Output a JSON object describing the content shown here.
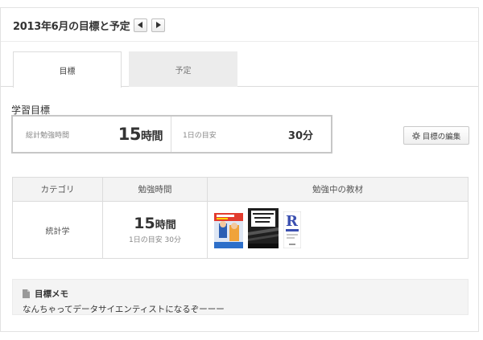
{
  "header": {
    "title": "2013年6月の目標と予定",
    "prev_icon": "triangle-left-icon",
    "next_icon": "triangle-right-icon"
  },
  "tabs": [
    {
      "label": "目標",
      "active": true
    },
    {
      "label": "予定",
      "active": false
    }
  ],
  "goal": {
    "section_label": "学習目標",
    "total_label": "総計勉強時間",
    "total_value": "15",
    "total_unit": "時間",
    "daily_label": "1日の目安",
    "daily_value": "30分"
  },
  "edit_button": {
    "label": "目標の編集",
    "icon": "gear-icon"
  },
  "table": {
    "headers": [
      "カテゴリ",
      "勉強時間",
      "勉強中の教材"
    ],
    "rows": [
      {
        "category": "統計学",
        "hours_value": "15",
        "hours_unit": "時間",
        "daily_note": "1日の目安 30分",
        "books": [
          "統計学 book cover",
          "その数学が戦略を決める book cover",
          "R book cover"
        ]
      }
    ]
  },
  "memo": {
    "title": "目標メモ",
    "icon": "memo-icon",
    "text": "なんちゃってデータサイエンティストになるぞーーー"
  },
  "colors": {
    "panel_border": "#e2e2e2",
    "tab_inactive_bg": "#ececec",
    "table_header_bg": "#f3f3f3",
    "memo_bg": "#f4f4f4"
  }
}
